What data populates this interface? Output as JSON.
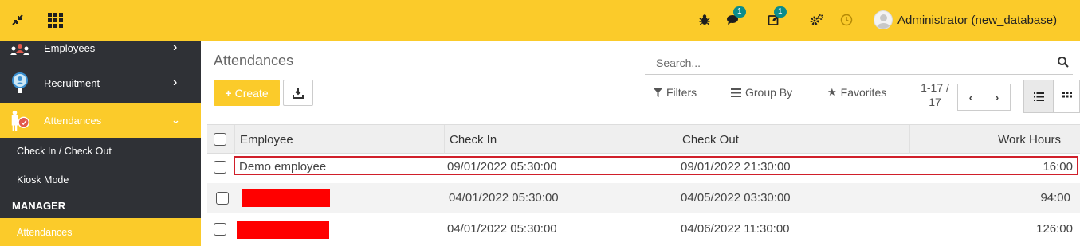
{
  "topbar": {
    "user_label": "Administrator (new_database)",
    "messages_count": "1",
    "activities_count": "1",
    "icons": [
      "collapse-icon",
      "apps-grid-icon",
      "bug-icon",
      "chat-icon",
      "activity-icon",
      "settings-icon",
      "clock-icon"
    ]
  },
  "sidebar": {
    "items": [
      {
        "label": "Employees"
      },
      {
        "label": "Recruitment"
      },
      {
        "label": "Attendances"
      }
    ],
    "sub_items": [
      {
        "label": "Check In / Check Out"
      },
      {
        "label": "Kiosk Mode"
      }
    ],
    "section": "MANAGER",
    "section_items": [
      {
        "label": "Attendances"
      }
    ]
  },
  "control": {
    "title": "Attendances",
    "create_label": "Create",
    "search_placeholder": "Search...",
    "filters_label": "Filters",
    "groupby_label": "Group By",
    "favorites_label": "Favorites",
    "pager_line1": "1-17 /",
    "pager_line2": "17"
  },
  "table": {
    "columns": [
      "Employee",
      "Check In",
      "Check Out",
      "Work Hours"
    ],
    "rows": [
      {
        "employee": "Demo employee",
        "check_in": "09/01/2022 05:30:00",
        "check_out": "09/01/2022 21:30:00",
        "hours": "16:00"
      },
      {
        "employee": "",
        "check_in": "04/01/2022 05:30:00",
        "check_out": "04/05/2022 03:30:00",
        "hours": "94:00"
      },
      {
        "employee": "",
        "check_in": "04/01/2022 05:30:00",
        "check_out": "04/06/2022 11:30:00",
        "hours": "126:00"
      }
    ]
  },
  "colors": {
    "accent": "#fbcb2a",
    "sidebar": "#2f3136",
    "badge": "#0b8c8c",
    "highlight": "#d01f2a",
    "redaction": "#ff0000"
  }
}
